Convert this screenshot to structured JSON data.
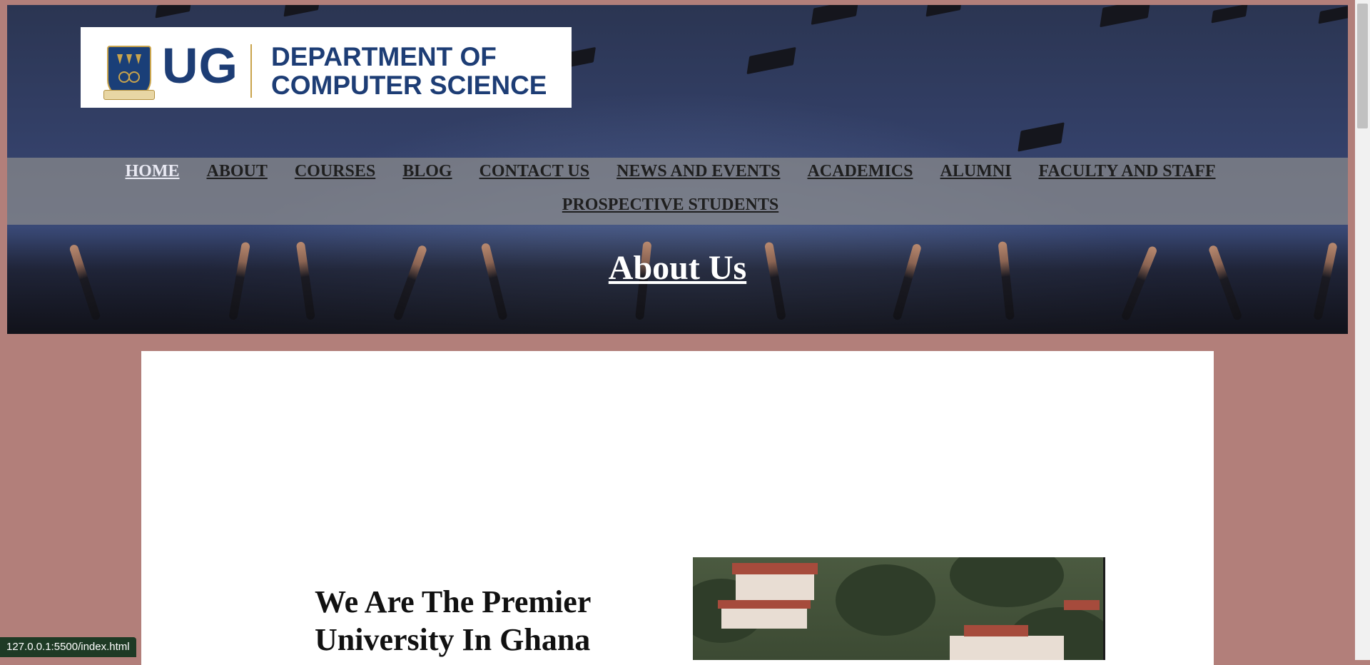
{
  "header": {
    "logo": {
      "initials": "UG",
      "department": "DEPARTMENT OF COMPUTER SCIENCE",
      "department_line1": "DEPARTMENT OF",
      "department_line2": "COMPUTER SCIENCE"
    },
    "nav": {
      "row1": [
        {
          "label": "HOME",
          "active": true
        },
        {
          "label": "ABOUT"
        },
        {
          "label": "COURSES"
        },
        {
          "label": "BLOG"
        },
        {
          "label": "CONTACT US"
        },
        {
          "label": "NEWS AND EVENTS"
        },
        {
          "label": "ACADEMICS"
        },
        {
          "label": "ALUMNI"
        },
        {
          "label": "FACULTY AND STAFF"
        }
      ],
      "row2": [
        {
          "label": "PROSPECTIVE STUDENTS"
        }
      ]
    },
    "hero_title": "About Us"
  },
  "main": {
    "headline": "We Are The Premier University In Ghana"
  },
  "status_bar": {
    "url": "127.0.0.1:5500/index.html"
  },
  "colors": {
    "page_background": "#b27f7a",
    "logo_blue": "#1d3d75",
    "logo_gold": "#c9a44c"
  }
}
